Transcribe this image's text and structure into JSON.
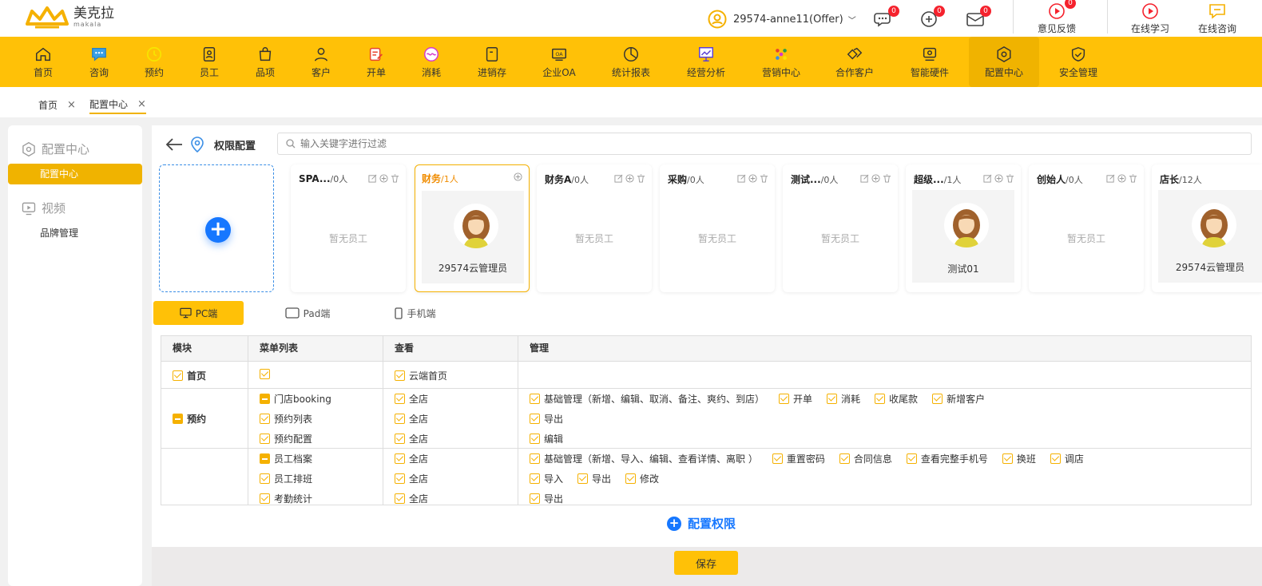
{
  "brand": {
    "name_cn": "美克拉",
    "name_en": "makala",
    "color": "#f5b100"
  },
  "header": {
    "user_label": "29574-anne11(Offer)",
    "badges": {
      "chat": "0",
      "message": "0",
      "mail": "0",
      "feedback": "0"
    },
    "feedback_label": "意见反馈",
    "learning_label": "在线学习",
    "consult_label": "在线咨询"
  },
  "nav": {
    "items": [
      {
        "label": "首页",
        "icon": "home-icon"
      },
      {
        "label": "咨询",
        "icon": "chat-icon"
      },
      {
        "label": "预约",
        "icon": "clock-icon"
      },
      {
        "label": "员工",
        "icon": "badge-icon"
      },
      {
        "label": "品项",
        "icon": "bag-icon"
      },
      {
        "label": "客户",
        "icon": "user-icon"
      },
      {
        "label": "开单",
        "icon": "edit-icon"
      },
      {
        "label": "消耗",
        "icon": "wave-icon"
      },
      {
        "label": "进销存",
        "icon": "box-icon"
      },
      {
        "label": "企业OA",
        "icon": "oa-icon"
      },
      {
        "label": "统计报表",
        "icon": "pie-icon"
      },
      {
        "label": "经营分析",
        "icon": "chart-icon"
      },
      {
        "label": "营销中心",
        "icon": "dots-icon"
      },
      {
        "label": "合作客户",
        "icon": "handshake-icon"
      },
      {
        "label": "智能硬件",
        "icon": "device-icon"
      },
      {
        "label": "配置中心",
        "icon": "gear-icon"
      },
      {
        "label": "安全管理",
        "icon": "shield-icon"
      }
    ],
    "active_index": 15
  },
  "tabs": [
    {
      "label": "首页",
      "close": "×"
    },
    {
      "label": "配置中心",
      "close": "×"
    }
  ],
  "sidebar": {
    "group1": "配置中心",
    "item1": "配置中心",
    "group2": "视频",
    "item2": "品牌管理"
  },
  "page": {
    "title": "权限配置",
    "search_placeholder": "输入关键字进行过滤"
  },
  "roles": [
    {
      "name": "SPA...",
      "count": "/0人",
      "empty": "暂无员工"
    },
    {
      "name": "财务",
      "count": "/1人",
      "member": "29574云管理员"
    },
    {
      "name": "财务A",
      "count": "/0人",
      "empty": "暂无员工"
    },
    {
      "name": "采购",
      "count": "/0人",
      "empty": "暂无员工"
    },
    {
      "name": "测试...",
      "count": "/0人",
      "empty": "暂无员工"
    },
    {
      "name": "超级...",
      "count": "/1人",
      "member": "测试01"
    },
    {
      "name": "创始人",
      "count": "/0人",
      "empty": "暂无员工"
    },
    {
      "name": "店长",
      "count": "/12人",
      "member": "29574云管理员"
    }
  ],
  "devices": [
    {
      "label": "PC端",
      "icon": "monitor-icon"
    },
    {
      "label": "Pad端",
      "icon": "tablet-icon"
    },
    {
      "label": "手机端",
      "icon": "phone-icon"
    }
  ],
  "table": {
    "headers": [
      "模块",
      "菜单列表",
      "查看",
      "管理"
    ],
    "modules": [
      "首页",
      "预约"
    ],
    "rows": [
      {
        "menu": "",
        "view": "云端首页",
        "manage": []
      },
      {
        "menu": "门店booking",
        "view": "全店",
        "manage": [
          "基础管理（新增、编辑、取消、备注、爽约、到店）",
          "开单",
          "消耗",
          "收尾款",
          "新增客户"
        ]
      },
      {
        "menu": "预约列表",
        "view": "全店",
        "manage": [
          "导出"
        ]
      },
      {
        "menu": "预约配置",
        "view": "全店",
        "manage": [
          "编辑"
        ]
      },
      {
        "menu": "员工档案",
        "view": "全店",
        "manage": [
          "基础管理（新增、导入、编辑、查看详情、离职 ）",
          "重置密码",
          "合同信息",
          "查看完整手机号",
          "换班",
          "调店"
        ]
      },
      {
        "menu": "员工排班",
        "view": "全店",
        "manage": [
          "导入",
          "导出",
          "修改"
        ]
      },
      {
        "menu": "考勤统计",
        "view": "全店",
        "manage": [
          "导出"
        ]
      }
    ]
  },
  "config_button": "配置权限",
  "save_button": "保存"
}
